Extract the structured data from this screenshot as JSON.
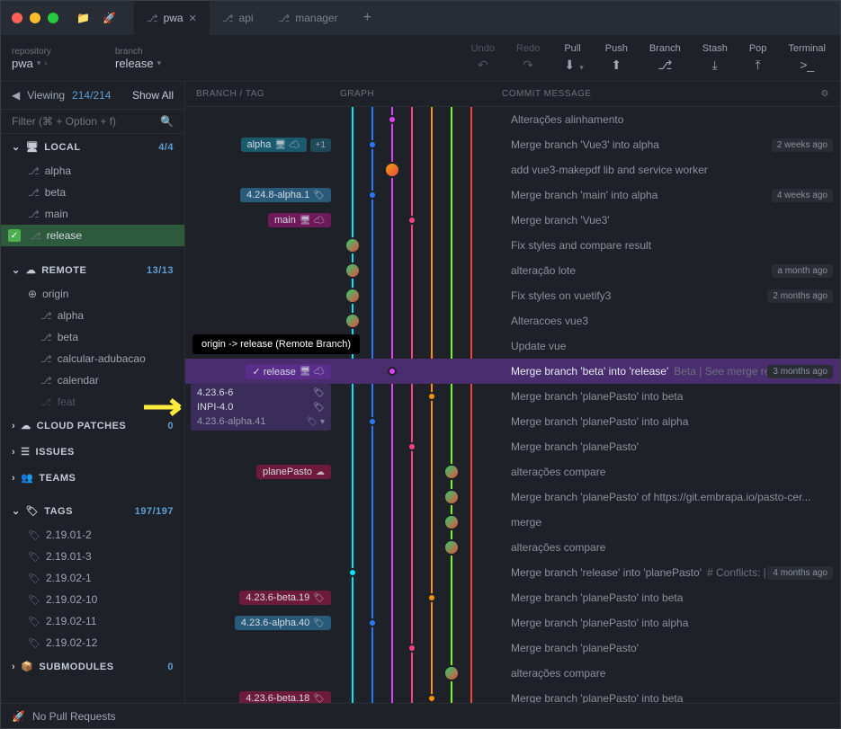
{
  "tabs": [
    {
      "label": "pwa",
      "active": true
    },
    {
      "label": "api",
      "active": false
    },
    {
      "label": "manager",
      "active": false
    }
  ],
  "repo": {
    "label": "repository",
    "value": "pwa"
  },
  "branch": {
    "label": "branch",
    "value": "release"
  },
  "toolbar": {
    "undo": "Undo",
    "redo": "Redo",
    "pull": "Pull",
    "push": "Push",
    "branch": "Branch",
    "stash": "Stash",
    "pop": "Pop",
    "terminal": "Terminal"
  },
  "view": {
    "label": "Viewing",
    "count": "214/214",
    "showall": "Show All",
    "filter_placeholder": "Filter (⌘ + Option + f)"
  },
  "sidebar": {
    "local": {
      "label": "LOCAL",
      "count": "4/4",
      "items": [
        "alpha",
        "beta",
        "main",
        "release"
      ],
      "selected": "release"
    },
    "remote": {
      "label": "REMOTE",
      "count": "13/13",
      "origin": "origin",
      "items": [
        "alpha",
        "beta",
        "calcular-adubacao",
        "calendar",
        "feat"
      ]
    },
    "cloud": {
      "label": "CLOUD PATCHES",
      "count": "0"
    },
    "issues": {
      "label": "ISSUES"
    },
    "teams": {
      "label": "TEAMS"
    },
    "tags": {
      "label": "TAGS",
      "count": "197/197",
      "items": [
        "2.19.01-2",
        "2.19.01-3",
        "2.19.02-1",
        "2.19.02-10",
        "2.19.02-11",
        "2.19.02-12"
      ]
    },
    "submodules": {
      "label": "SUBMODULES",
      "count": "0"
    }
  },
  "graph_header": {
    "branch": "BRANCH / TAG",
    "graph": "GRAPH",
    "msg": "COMMIT MESSAGE"
  },
  "tooltip": "origin -> release (Remote Branch)",
  "refs": {
    "alpha": "alpha",
    "alpha_count": "+1",
    "tag1": "4.24.8-alpha.1",
    "main": "main",
    "release": "release",
    "rel_tag1": "4.23.6-6",
    "rel_tag2": "INPI-4.0",
    "rel_tag3": "4.23.6-alpha.41",
    "plane": "planePasto",
    "beta19": "4.23.6-beta.19",
    "alpha40": "4.23.6-alpha.40",
    "beta18": "4.23.6-beta.18"
  },
  "commits": [
    {
      "msg": "Alterações alinhamento",
      "time": ""
    },
    {
      "msg": "Merge branch 'Vue3' into alpha",
      "time": "2 weeks ago"
    },
    {
      "msg": "add vue3-makepdf lib and service worker",
      "time": ""
    },
    {
      "msg": "Merge branch 'main' into alpha",
      "time": "4 weeks ago"
    },
    {
      "msg": "Merge branch 'Vue3'",
      "time": ""
    },
    {
      "msg": "Fix styles and compare result",
      "time": ""
    },
    {
      "msg": "alteração lote",
      "time": "a month ago"
    },
    {
      "msg": "Fix styles on vuetify3",
      "time": "2 months ago"
    },
    {
      "msg": "Alteracoes vue3",
      "time": ""
    },
    {
      "msg": "Update vue",
      "time": ""
    },
    {
      "msg": "Merge branch 'beta' into 'release'",
      "extra": "Beta | See merge request ...",
      "time": "3 months ago",
      "selected": true
    },
    {
      "msg": "Merge branch 'planePasto' into beta",
      "time": ""
    },
    {
      "msg": "Merge branch 'planePasto' into alpha",
      "time": ""
    },
    {
      "msg": "Merge branch 'planePasto'",
      "time": ""
    },
    {
      "msg": "alterações compare",
      "time": ""
    },
    {
      "msg": "Merge branch 'planePasto' of https://git.embrapa.io/pasto-cer...",
      "time": ""
    },
    {
      "msg": "merge",
      "time": ""
    },
    {
      "msg": "alterações compare",
      "time": ""
    },
    {
      "msg": "Merge branch 'release' into 'planePasto'",
      "extra": "# Conflicts: | # src/vi...",
      "time": "4 months ago"
    },
    {
      "msg": "Merge branch 'planePasto' into beta",
      "time": ""
    },
    {
      "msg": "Merge branch 'planePasto' into alpha",
      "time": ""
    },
    {
      "msg": "Merge branch 'planePasto'",
      "time": ""
    },
    {
      "msg": "alterações compare",
      "time": ""
    },
    {
      "msg": "Merge branch 'planePasto' into beta",
      "time": ""
    }
  ],
  "status": {
    "pr": "No Pull Requests"
  }
}
